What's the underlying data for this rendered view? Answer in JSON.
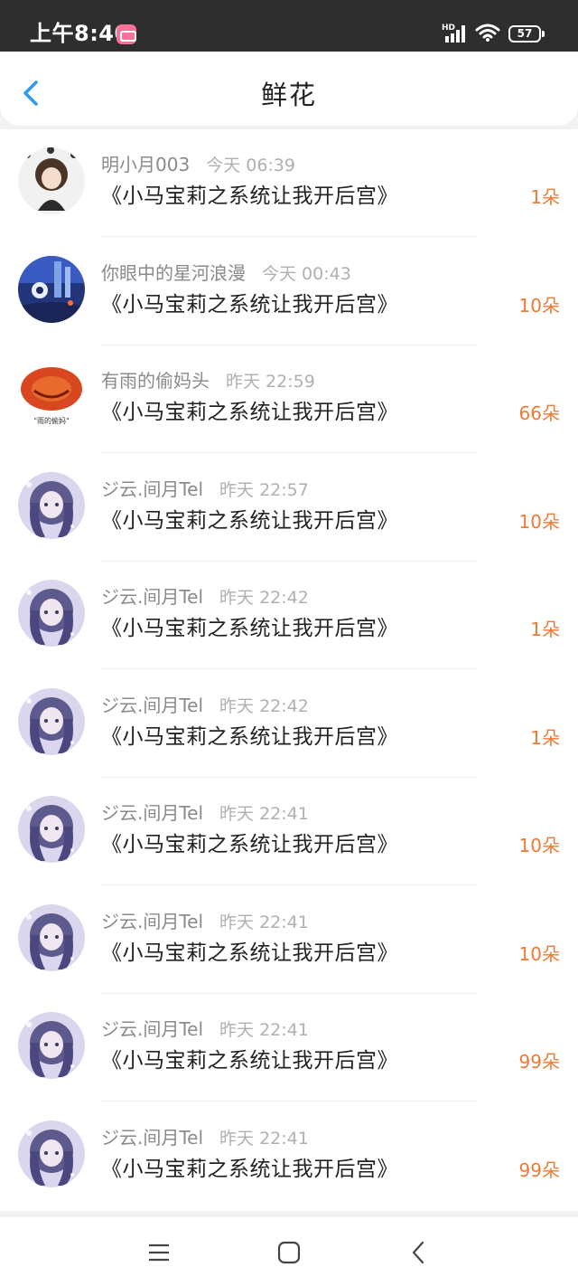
{
  "status_bar": {
    "time": "上午8:40",
    "network_label": "HD",
    "battery": "57",
    "icons": [
      "app-notification-icon",
      "signal-icon",
      "wifi-icon",
      "battery-icon"
    ]
  },
  "header": {
    "title": "鲜花",
    "back_icon": "chevron-left-icon",
    "accent_color": "#2f9bf0"
  },
  "flower_list": [
    {
      "user": "明小月003",
      "time": "今天 06:39",
      "book": "《小马宝莉之系统让我开后宫》",
      "count": "1朵",
      "avatar": "anime-girl-dark"
    },
    {
      "user": "你眼中的星河浪漫",
      "time": "今天 00:43",
      "book": "《小马宝莉之系统让我开后宫》",
      "count": "10朵",
      "avatar": "night-sky"
    },
    {
      "user": "有雨的偷妈头",
      "time": "昨天 22:59",
      "book": "《小马宝莉之系统让我开后宫》",
      "count": "66朵",
      "avatar": "orange-pumpkin"
    },
    {
      "user": "ジ云.间月Tel",
      "time": "昨天 22:57",
      "book": "《小马宝莉之系统让我开后宫》",
      "count": "10朵",
      "avatar": "anime-girl-purple"
    },
    {
      "user": "ジ云.间月Tel",
      "time": "昨天 22:42",
      "book": "《小马宝莉之系统让我开后宫》",
      "count": "1朵",
      "avatar": "anime-girl-purple"
    },
    {
      "user": "ジ云.间月Tel",
      "time": "昨天 22:42",
      "book": "《小马宝莉之系统让我开后宫》",
      "count": "1朵",
      "avatar": "anime-girl-purple"
    },
    {
      "user": "ジ云.间月Tel",
      "time": "昨天 22:41",
      "book": "《小马宝莉之系统让我开后宫》",
      "count": "10朵",
      "avatar": "anime-girl-purple"
    },
    {
      "user": "ジ云.间月Tel",
      "time": "昨天 22:41",
      "book": "《小马宝莉之系统让我开后宫》",
      "count": "10朵",
      "avatar": "anime-girl-purple"
    },
    {
      "user": "ジ云.间月Tel",
      "time": "昨天 22:41",
      "book": "《小马宝莉之系统让我开后宫》",
      "count": "99朵",
      "avatar": "anime-girl-purple"
    },
    {
      "user": "ジ云.间月Tel",
      "time": "昨天 22:41",
      "book": "《小马宝莉之系统让我开后宫》",
      "count": "99朵",
      "avatar": "anime-girl-purple"
    }
  ],
  "nav_bar": {
    "icons": [
      "menu-icon",
      "home-icon",
      "back-icon"
    ]
  },
  "colors": {
    "count_color": "#f07a33",
    "title_text": "#222222",
    "meta_text": "#8a8a8a"
  }
}
